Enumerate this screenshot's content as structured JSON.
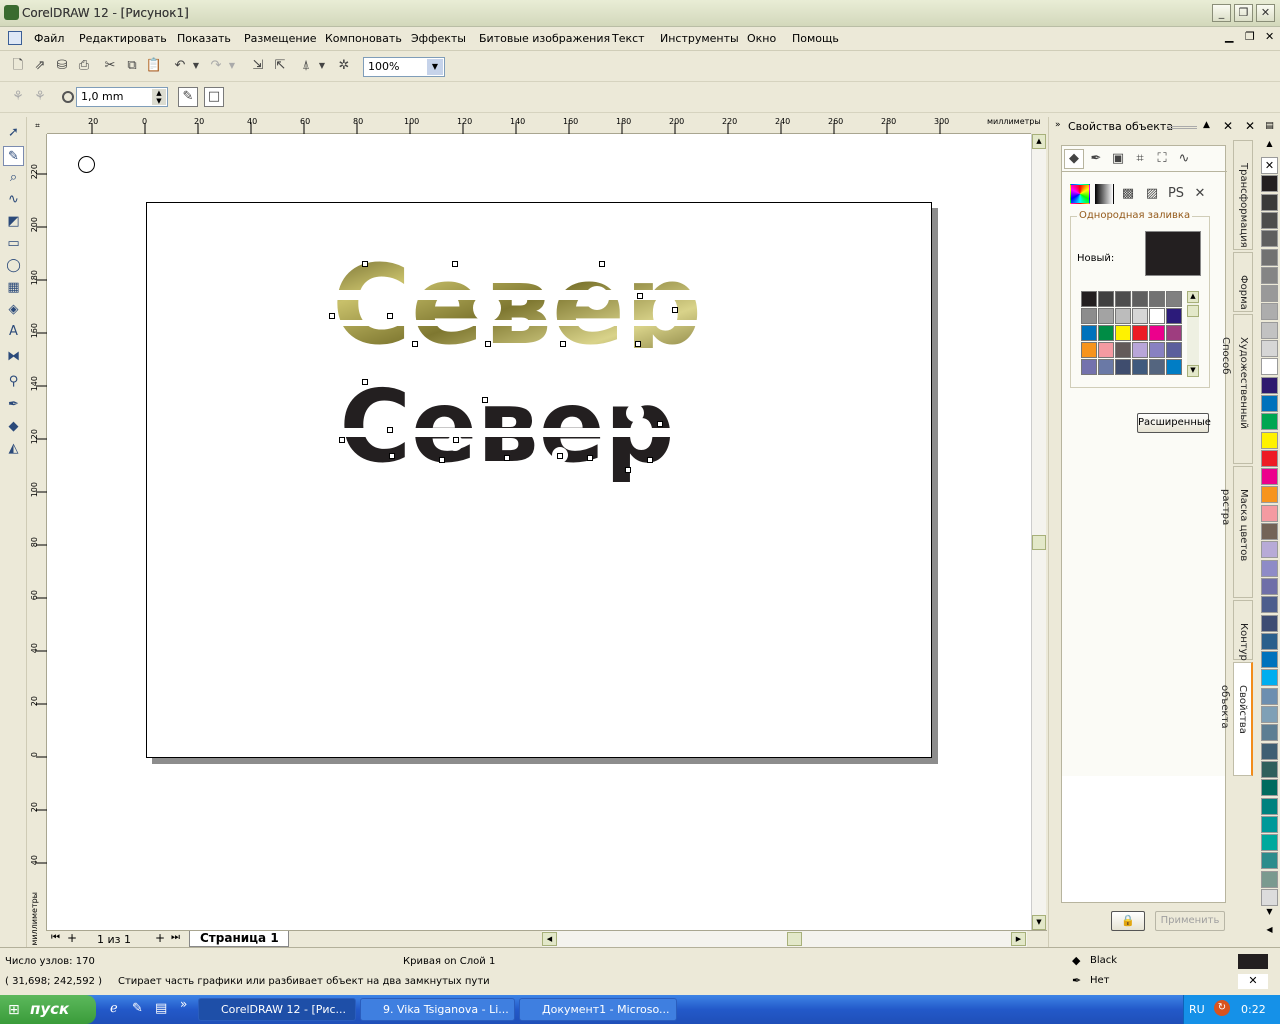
{
  "window": {
    "title": "CorelDRAW 12 - [Рисунок1]"
  },
  "menu": [
    "Файл",
    "Редактировать",
    "Показать",
    "Размещение",
    "Компоновать",
    "Эффекты",
    "Битовые изображения",
    "Текст",
    "Инструменты",
    "Окно",
    "Помощь"
  ],
  "toolbar": {
    "zoom": "100%",
    "nib_size": "1,0 mm"
  },
  "ruler": {
    "unit": "миллиметры",
    "h_ticks": [
      "20",
      "0",
      "20",
      "40",
      "60",
      "80",
      "100",
      "120",
      "140",
      "160",
      "180",
      "200",
      "220",
      "240",
      "260",
      "280",
      "300"
    ],
    "v_ticks": [
      "220",
      "200",
      "180",
      "160",
      "140",
      "120",
      "100",
      "80",
      "60",
      "40",
      "20",
      "0",
      "20",
      "40"
    ]
  },
  "artwork": {
    "top_text": "Север",
    "bottom_text": "Север",
    "texture_color": "#a39a3c",
    "text_color": "#231f20"
  },
  "page_nav": {
    "counter": "1 из 1",
    "tab": "Страница 1"
  },
  "docker": {
    "title": "Свойства объекта",
    "group_label": "Однородная заливка",
    "new_label": "Новый:",
    "new_color": "#231f20",
    "advanced_button": "Расширенные",
    "apply_button": "Применить",
    "swatches": [
      "#231f20",
      "#404040",
      "#4d4d4d",
      "#5f5f5f",
      "#727272",
      "#808080",
      "#8d8d8d",
      "#a3a3a3",
      "#bcbcbc",
      "#d6d6d6",
      "#ffffff",
      "#2c1b7a",
      "#0072bc",
      "#008c45",
      "#fff200",
      "#ed1c24",
      "#ec008c",
      "#9e3d7f",
      "#f7941d",
      "#f49aa1",
      "#635a59",
      "#b8a6d9",
      "#8881c2",
      "#5b5f9c",
      "#7472ad",
      "#6a79a6",
      "#3f4d6e",
      "#3f5a7d",
      "#54657f",
      "#007dc5"
    ]
  },
  "docker_tabs": [
    "Трансформация",
    "Форма",
    "Художественный Способ",
    "Маска цветов растра",
    "Контур",
    "Свойства объекта"
  ],
  "palette": [
    "#ffffff",
    "#231f20",
    "#3a3a3a",
    "#4d4d4d",
    "#5f5f5f",
    "#727272",
    "#858585",
    "#999999",
    "#adadad",
    "#c2c2c2",
    "#d6d6d6",
    "#ffffff",
    "#2e1a6f",
    "#0072bc",
    "#00a651",
    "#fff200",
    "#ed1c24",
    "#ec008c",
    "#f7941d",
    "#f49aa1",
    "#736357",
    "#b7aad7",
    "#8e8bc7",
    "#6f6fa8",
    "#4d5e8d",
    "#3d4c73",
    "#2b5f8c",
    "#0072bc",
    "#00aeef",
    "#6d8fb0",
    "#7fa0b6",
    "#5d7e93",
    "#3f5e73",
    "#2f5f5c",
    "#006b5f",
    "#00827f",
    "#009999",
    "#00a99d",
    "#2c8c8c",
    "#7a9a8f",
    "#dcdcdc"
  ],
  "status": {
    "nodes": "Число узлов: 170",
    "object": "Кривая on Слой 1",
    "coords": "( 31,698; 242,592 )",
    "hint": "Стирает часть графики или разбивает объект на два замкнутых пути",
    "fill_name": "Black",
    "outline_name": "Нет"
  },
  "taskbar": {
    "start": "пуск",
    "tasks": [
      "CorelDRAW 12 - [Рис...",
      "9. Vika Tsiganova - Li...",
      "Документ1 - Microso..."
    ],
    "lang": "RU",
    "clock": "0:22"
  }
}
